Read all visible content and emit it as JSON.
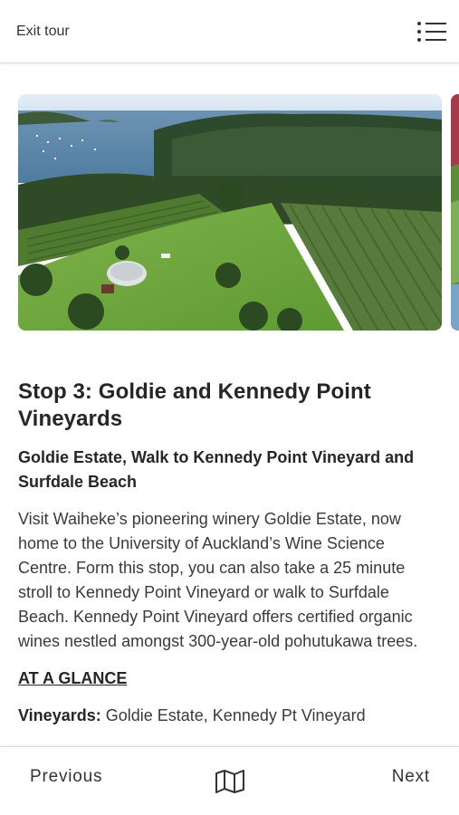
{
  "header": {
    "exit_label": "Exit tour",
    "menu_icon": "list-menu-icon"
  },
  "carousel": {
    "main_image": "aerial-vineyard-photo",
    "next_image": "next-slide-photo"
  },
  "stop": {
    "title": "Stop 3: Goldie and Kennedy Point Vineyards",
    "subtitle": "Goldie Estate, Walk to Kennedy Point Vineyard and Surfdale Beach",
    "description": "Visit Waiheke’s pioneering winery Goldie Estate, now home to the University of Auckland’s Wine Science Centre. Form this stop, you can also take a 25 minute stroll to Kennedy Point Vineyard or walk to Surfdale Beach. Kennedy Point Vineyard offers certified organic wines nestled amongst 300-year-old pohutukawa trees.",
    "glance_heading": "AT A GLANCE",
    "vineyards_label": "Vineyards:",
    "vineyards_value": "Goldie Estate, Kennedy Pt Vineyard"
  },
  "footer": {
    "previous_label": "Previous",
    "next_label": "Next",
    "map_icon": "map-icon"
  }
}
